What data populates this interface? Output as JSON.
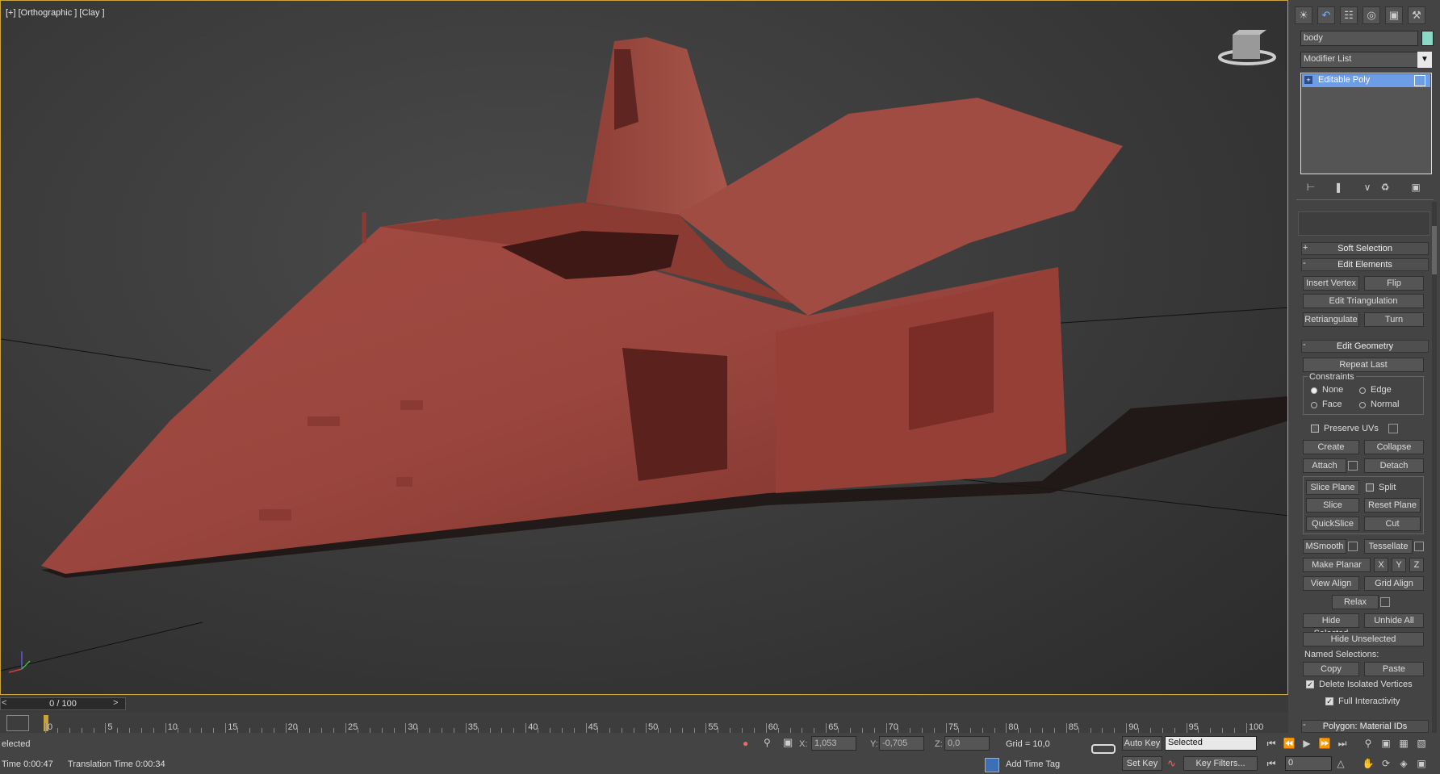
{
  "viewport": {
    "label": "[+] [Orthographic ] [Clay ]"
  },
  "timeline": {
    "frame": "0 / 100",
    "prev": "<",
    "next": ">",
    "ticks": [
      "0",
      "5",
      "10",
      "15",
      "20",
      "25",
      "30",
      "35",
      "40",
      "45",
      "50",
      "55",
      "60",
      "65",
      "70",
      "75",
      "80",
      "85",
      "90",
      "95",
      "100"
    ]
  },
  "status": {
    "selection": "elected",
    "x_label": "X:",
    "x_value": "1,053",
    "y_label": "Y:",
    "y_value": "-0,705",
    "z_label": "Z:",
    "z_value": "0,0",
    "grid": "Grid = 10,0",
    "time": "Time  0:00:47",
    "translation": "Translation Time  0:00:34",
    "add_time_tag": "Add Time Tag"
  },
  "anim": {
    "auto_key": "Auto Key",
    "set_key": "Set Key",
    "selected_dropdown": "Selected",
    "key_filters": "Key Filters...",
    "frame_field": "0"
  },
  "panel": {
    "object_name": "body",
    "object_color": "#8ad8c6",
    "modifier_list": "Modifier List",
    "stack_item": "Editable Poly",
    "rollouts": {
      "soft_selection": "Soft Selection",
      "edit_elements": "Edit Elements",
      "edit_geometry": "Edit Geometry",
      "polygon_material_ids": "Polygon: Material IDs"
    },
    "buttons": {
      "insert_vertex": "Insert Vertex",
      "flip": "Flip",
      "edit_triangulation": "Edit Triangulation",
      "retriangulate": "Retriangulate",
      "turn": "Turn",
      "repeat_last": "Repeat Last",
      "create": "Create",
      "collapse": "Collapse",
      "attach": "Attach",
      "detach": "Detach",
      "slice_plane": "Slice Plane",
      "split": "Split",
      "slice": "Slice",
      "reset_plane": "Reset Plane",
      "quickslice": "QuickSlice",
      "cut": "Cut",
      "msmooth": "MSmooth",
      "tessellate": "Tessellate",
      "make_planar": "Make Planar",
      "x": "X",
      "y": "Y",
      "z": "Z",
      "view_align": "View Align",
      "grid_align": "Grid Align",
      "relax": "Relax",
      "hide_selected": "Hide Selected",
      "unhide_all": "Unhide All",
      "hide_unselected": "Hide Unselected",
      "copy": "Copy",
      "paste": "Paste"
    },
    "constraints": {
      "label": "Constraints",
      "none": "None",
      "edge": "Edge",
      "face": "Face",
      "normal": "Normal"
    },
    "preserve_uvs": "Preserve UVs",
    "named_selections": "Named Selections:",
    "delete_isolated": "Delete Isolated Vertices",
    "full_interactivity": "Full Interactivity"
  }
}
